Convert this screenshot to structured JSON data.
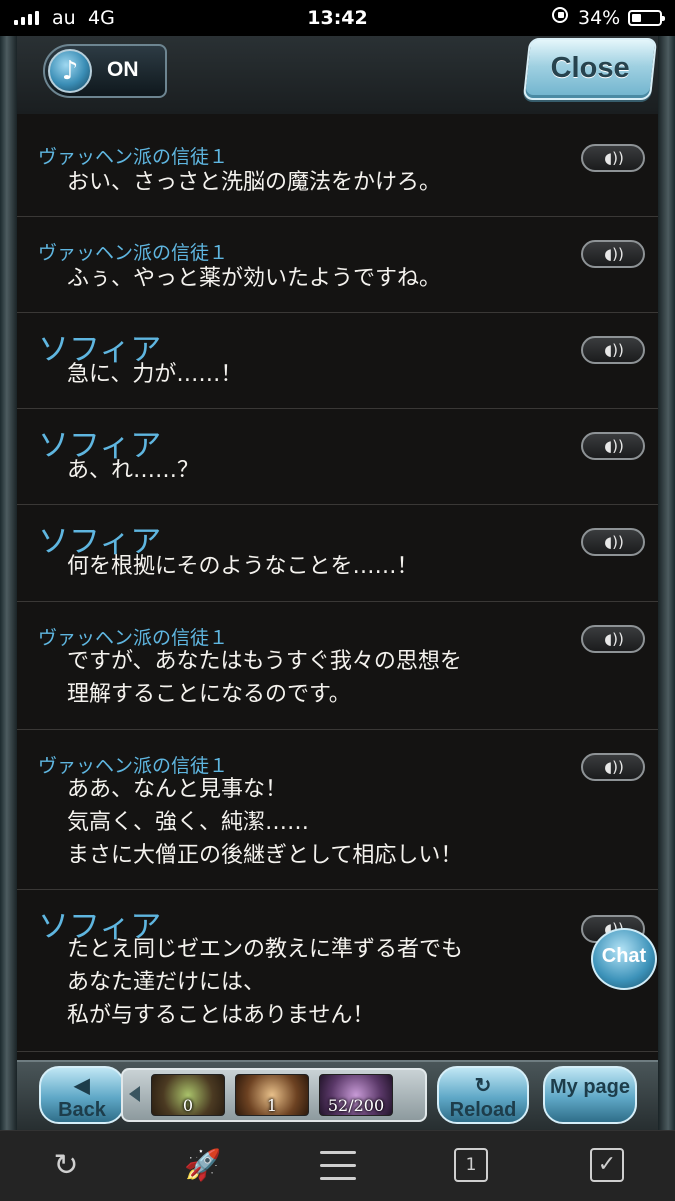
{
  "status_bar": {
    "carrier": "au",
    "network": "4G",
    "time": "13:42",
    "battery": "34%"
  },
  "music": {
    "icon": "music-note-icon",
    "state": "ON"
  },
  "close_label": "Close",
  "entries": [
    {
      "speaker": "ヴァッヘン派の信徒１",
      "text": "おい、さっさと洗脳の魔法をかけろ。"
    },
    {
      "speaker": "ヴァッヘン派の信徒１",
      "text": "ふぅ、やっと薬が効いたようですね。"
    },
    {
      "speaker": "ソフィア",
      "text": "急に、力が……！"
    },
    {
      "speaker": "ソフィア",
      "text": "あ、れ……？"
    },
    {
      "speaker": "ソフィア",
      "text": "何を根拠にそのようなことを……！"
    },
    {
      "speaker": "ヴァッヘン派の信徒１",
      "text": "ですが、あなたはもうすぐ我々の思想を\n理解することになるのです。"
    },
    {
      "speaker": "ヴァッヘン派の信徒１",
      "text": "ああ、なんと見事な！\n気高く、強く、純潔……\nまさに大僧正の後継ぎとして相応しい！"
    },
    {
      "speaker": "ソフィア",
      "text": "たとえ同じゼエンの教えに準ずる者でも\nあなた達だけには、\n私が与することはありません！"
    }
  ],
  "chat_label": "Chat",
  "footer": {
    "back_label": "Back",
    "reload_label": "Reload",
    "mypage_label": "My page",
    "items": [
      {
        "count": "0"
      },
      {
        "count": "1"
      },
      {
        "count": "52/200"
      }
    ]
  },
  "browser": {
    "tab_count": "1"
  }
}
